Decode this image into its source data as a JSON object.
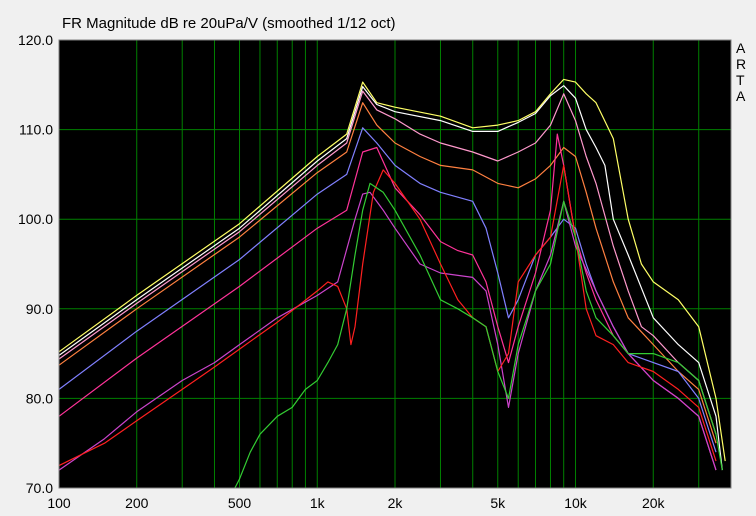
{
  "chart_data": {
    "type": "line",
    "title": "FR Magnitude dB re 20uPa/V (smoothed 1/12 oct)",
    "xscale": "log",
    "xlim": [
      100,
      40000
    ],
    "ylim": [
      70,
      120
    ],
    "grid": true,
    "background": "#000000",
    "grid_color": "#008000",
    "x_ticks": [
      {
        "value": 100,
        "label": "100"
      },
      {
        "value": 200,
        "label": "200"
      },
      {
        "value": 500,
        "label": "500"
      },
      {
        "value": 1000,
        "label": "1k"
      },
      {
        "value": 2000,
        "label": "2k"
      },
      {
        "value": 5000,
        "label": "5k"
      },
      {
        "value": 10000,
        "label": "10k"
      },
      {
        "value": 20000,
        "label": "20k"
      }
    ],
    "y_ticks": [
      {
        "value": 70,
        "label": "70.0"
      },
      {
        "value": 80,
        "label": "80.0"
      },
      {
        "value": 90,
        "label": "90.0"
      },
      {
        "value": 100,
        "label": "100.0"
      },
      {
        "value": 110,
        "label": "110.0"
      },
      {
        "value": 120,
        "label": "120.0"
      }
    ],
    "series": [
      {
        "color": "#ffff66",
        "points": [
          [
            100,
            85.2
          ],
          [
            200,
            91.5
          ],
          [
            500,
            99.5
          ],
          [
            1000,
            107
          ],
          [
            1300,
            109.5
          ],
          [
            1500,
            115.3
          ],
          [
            1700,
            113
          ],
          [
            2000,
            112.5
          ],
          [
            3000,
            111.5
          ],
          [
            4000,
            110.2
          ],
          [
            5000,
            110.5
          ],
          [
            6000,
            111
          ],
          [
            7000,
            112
          ],
          [
            8000,
            114
          ],
          [
            9000,
            115.6
          ],
          [
            10000,
            115.3
          ],
          [
            11000,
            114
          ],
          [
            12000,
            113
          ],
          [
            14000,
            109
          ],
          [
            16000,
            100
          ],
          [
            18000,
            95
          ],
          [
            20000,
            93
          ],
          [
            25000,
            91
          ],
          [
            30000,
            88
          ],
          [
            35000,
            80
          ],
          [
            38000,
            73
          ]
        ]
      },
      {
        "color": "#ffffff",
        "points": [
          [
            100,
            84.8
          ],
          [
            200,
            91
          ],
          [
            500,
            99
          ],
          [
            1000,
            106.5
          ],
          [
            1300,
            109
          ],
          [
            1500,
            114.8
          ],
          [
            1700,
            112.8
          ],
          [
            2000,
            112
          ],
          [
            3000,
            111
          ],
          [
            4000,
            109.8
          ],
          [
            5000,
            109.8
          ],
          [
            6000,
            110.8
          ],
          [
            7000,
            111.8
          ],
          [
            8000,
            113.8
          ],
          [
            9000,
            114.9
          ],
          [
            10000,
            113.5
          ],
          [
            11000,
            110
          ],
          [
            12000,
            108
          ],
          [
            13000,
            106
          ],
          [
            14000,
            100
          ],
          [
            16000,
            96
          ],
          [
            20000,
            89
          ],
          [
            25000,
            86
          ],
          [
            30000,
            84
          ],
          [
            35000,
            78
          ],
          [
            37000,
            72
          ]
        ]
      },
      {
        "color": "#ff99cc",
        "points": [
          [
            100,
            84.4
          ],
          [
            200,
            90.6
          ],
          [
            500,
            98.6
          ],
          [
            1000,
            106
          ],
          [
            1300,
            108.5
          ],
          [
            1500,
            114.3
          ],
          [
            1700,
            112.2
          ],
          [
            2000,
            111.2
          ],
          [
            2500,
            109.5
          ],
          [
            3000,
            108.5
          ],
          [
            4000,
            107.5
          ],
          [
            5000,
            106.5
          ],
          [
            6000,
            107.5
          ],
          [
            7000,
            108.5
          ],
          [
            8000,
            110.5
          ],
          [
            9000,
            114
          ],
          [
            10000,
            111
          ],
          [
            11000,
            107
          ],
          [
            12000,
            104
          ],
          [
            14000,
            97
          ],
          [
            16000,
            92
          ],
          [
            18000,
            88
          ],
          [
            20000,
            87
          ],
          [
            25000,
            84
          ],
          [
            30000,
            82
          ],
          [
            35000,
            76
          ]
        ]
      },
      {
        "color": "#ff8040",
        "points": [
          [
            100,
            83.7
          ],
          [
            200,
            90
          ],
          [
            500,
            98
          ],
          [
            1000,
            105.2
          ],
          [
            1300,
            107.5
          ],
          [
            1500,
            113
          ],
          [
            1700,
            110.5
          ],
          [
            2000,
            108.5
          ],
          [
            2500,
            107
          ],
          [
            3000,
            106
          ],
          [
            4000,
            105.5
          ],
          [
            5000,
            104
          ],
          [
            6000,
            103.5
          ],
          [
            7000,
            104.5
          ],
          [
            8000,
            106
          ],
          [
            9000,
            108
          ],
          [
            10000,
            107
          ],
          [
            11000,
            103
          ],
          [
            12000,
            99
          ],
          [
            14000,
            93
          ],
          [
            16000,
            89
          ],
          [
            20000,
            86
          ],
          [
            25000,
            83
          ],
          [
            30000,
            81
          ],
          [
            35000,
            75
          ]
        ]
      },
      {
        "color": "#8080ff",
        "points": [
          [
            100,
            81
          ],
          [
            200,
            87.5
          ],
          [
            500,
            95.5
          ],
          [
            1000,
            102.8
          ],
          [
            1300,
            105
          ],
          [
            1500,
            110.2
          ],
          [
            1700,
            108.5
          ],
          [
            2000,
            106
          ],
          [
            2500,
            104
          ],
          [
            3000,
            103
          ],
          [
            4000,
            102
          ],
          [
            4500,
            99
          ],
          [
            5000,
            94
          ],
          [
            5500,
            89
          ],
          [
            6000,
            91
          ],
          [
            7000,
            96
          ],
          [
            8000,
            98
          ],
          [
            9000,
            100
          ],
          [
            10000,
            99
          ],
          [
            11000,
            95
          ],
          [
            12000,
            92
          ],
          [
            14000,
            88
          ],
          [
            16000,
            85
          ],
          [
            20000,
            84
          ],
          [
            25000,
            83
          ],
          [
            30000,
            80
          ],
          [
            35000,
            74
          ]
        ]
      },
      {
        "color": "#ff3399",
        "points": [
          [
            100,
            78
          ],
          [
            200,
            84.5
          ],
          [
            500,
            92.5
          ],
          [
            1000,
            99
          ],
          [
            1300,
            101
          ],
          [
            1500,
            107.5
          ],
          [
            1700,
            108
          ],
          [
            2000,
            103.5
          ],
          [
            2500,
            100.5
          ],
          [
            3000,
            97.5
          ],
          [
            3500,
            96.5
          ],
          [
            4000,
            96
          ],
          [
            4500,
            93
          ],
          [
            5000,
            88
          ],
          [
            5500,
            84
          ],
          [
            6000,
            88
          ],
          [
            7000,
            94
          ],
          [
            8000,
            101
          ],
          [
            8500,
            109.5
          ],
          [
            9000,
            106
          ],
          [
            10000,
            98
          ],
          [
            11000,
            94
          ],
          [
            12000,
            91
          ],
          [
            14000,
            87
          ],
          [
            16000,
            85
          ],
          [
            20000,
            82
          ],
          [
            25000,
            80
          ],
          [
            30000,
            78
          ],
          [
            35000,
            72
          ]
        ]
      },
      {
        "color": "#cc44cc",
        "points": [
          [
            100,
            72
          ],
          [
            150,
            75.5
          ],
          [
            200,
            78.5
          ],
          [
            300,
            82
          ],
          [
            400,
            84
          ],
          [
            500,
            86
          ],
          [
            700,
            89
          ],
          [
            1000,
            91.5
          ],
          [
            1200,
            93
          ],
          [
            1400,
            100
          ],
          [
            1500,
            102.8
          ],
          [
            1600,
            103
          ],
          [
            1800,
            101
          ],
          [
            2000,
            99
          ],
          [
            2500,
            95
          ],
          [
            3000,
            94
          ],
          [
            4000,
            93.5
          ],
          [
            4500,
            92
          ],
          [
            5000,
            86
          ],
          [
            5500,
            79
          ],
          [
            6000,
            85
          ],
          [
            7000,
            92
          ],
          [
            8000,
            96
          ],
          [
            9000,
            102
          ],
          [
            10000,
            97
          ],
          [
            12000,
            92
          ],
          [
            14000,
            88
          ],
          [
            16000,
            85
          ],
          [
            20000,
            82
          ],
          [
            25000,
            80
          ],
          [
            30000,
            78
          ],
          [
            35000,
            72
          ]
        ]
      },
      {
        "color": "#ff2020",
        "points": [
          [
            100,
            72.5
          ],
          [
            150,
            75
          ],
          [
            200,
            77.5
          ],
          [
            300,
            81
          ],
          [
            400,
            83.5
          ],
          [
            500,
            85.5
          ],
          [
            700,
            88.5
          ],
          [
            1000,
            92
          ],
          [
            1100,
            93
          ],
          [
            1200,
            92.5
          ],
          [
            1300,
            90
          ],
          [
            1350,
            86
          ],
          [
            1400,
            88
          ],
          [
            1500,
            95
          ],
          [
            1650,
            103
          ],
          [
            1800,
            105.5
          ],
          [
            2000,
            104
          ],
          [
            2500,
            100
          ],
          [
            3000,
            95
          ],
          [
            3500,
            91
          ],
          [
            4000,
            89
          ],
          [
            4500,
            88
          ],
          [
            5000,
            83
          ],
          [
            5500,
            85
          ],
          [
            6000,
            93
          ],
          [
            7000,
            96
          ],
          [
            8000,
            98
          ],
          [
            9000,
            106
          ],
          [
            10000,
            98
          ],
          [
            11000,
            90
          ],
          [
            12000,
            87
          ],
          [
            14000,
            86
          ],
          [
            16000,
            84
          ],
          [
            20000,
            83
          ],
          [
            25000,
            81
          ],
          [
            30000,
            79
          ],
          [
            35000,
            73
          ]
        ]
      },
      {
        "color": "#33cc33",
        "points": [
          [
            480,
            70
          ],
          [
            500,
            71
          ],
          [
            550,
            74
          ],
          [
            600,
            76
          ],
          [
            700,
            78
          ],
          [
            800,
            79
          ],
          [
            900,
            81
          ],
          [
            1000,
            82
          ],
          [
            1100,
            84
          ],
          [
            1200,
            86
          ],
          [
            1300,
            90
          ],
          [
            1400,
            96
          ],
          [
            1500,
            101
          ],
          [
            1600,
            104
          ],
          [
            1800,
            103
          ],
          [
            2000,
            101
          ],
          [
            2500,
            96
          ],
          [
            3000,
            91
          ],
          [
            3500,
            90
          ],
          [
            4000,
            89
          ],
          [
            4500,
            88
          ],
          [
            5000,
            83
          ],
          [
            5500,
            80
          ],
          [
            6000,
            86
          ],
          [
            7000,
            92
          ],
          [
            8000,
            95
          ],
          [
            9000,
            102
          ],
          [
            10000,
            98
          ],
          [
            11000,
            92
          ],
          [
            12000,
            89
          ],
          [
            14000,
            87
          ],
          [
            16000,
            85
          ],
          [
            20000,
            85
          ],
          [
            25000,
            84
          ],
          [
            30000,
            82
          ],
          [
            35000,
            76
          ],
          [
            37000,
            72
          ]
        ]
      }
    ]
  },
  "side_label": [
    "A",
    "R",
    "T",
    "A"
  ]
}
